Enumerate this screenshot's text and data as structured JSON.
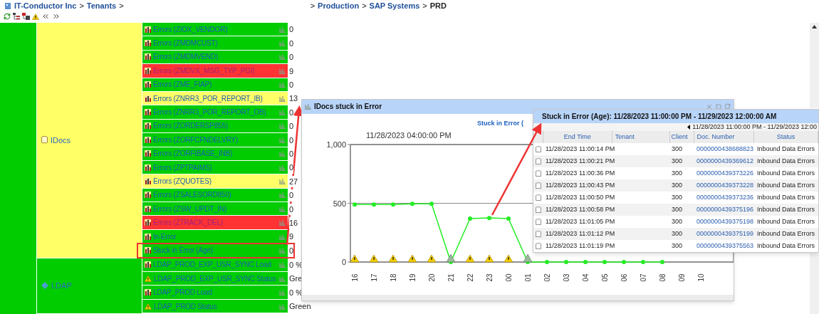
{
  "breadcrumb": {
    "start": [
      {
        "label": "IT-Conductor Inc",
        "kind": "link"
      },
      {
        "label": ">",
        "kind": "sep"
      },
      {
        "label": "Tenants",
        "kind": "link"
      },
      {
        "label": ">",
        "kind": "sep"
      }
    ],
    "end": [
      {
        "label": ">",
        "kind": "sep"
      },
      {
        "label": "Production",
        "kind": "link"
      },
      {
        "label": ">",
        "kind": "sep"
      },
      {
        "label": "SAP Systems",
        "kind": "link"
      },
      {
        "label": ">",
        "kind": "sep"
      },
      {
        "label": "PRD",
        "kind": "current"
      }
    ]
  },
  "toolbar": [
    {
      "kind": "refresh"
    },
    {
      "kind": "tree"
    },
    {
      "kind": "tree-red"
    },
    {
      "kind": "warning"
    },
    {
      "kind": "prev"
    },
    {
      "kind": "next"
    }
  ],
  "root": {
    "color": "#00cc00"
  },
  "groups": [
    {
      "label": "IDocs",
      "kind": "database",
      "color": "#ffff66",
      "rows": [
        {
          "name": "Errors (ZIOX_VENDOR)",
          "color": "#00cc00",
          "kind": "metric",
          "value": "0",
          "highlighted": false
        },
        {
          "name": "Errors (ZMDMCUST)",
          "color": "#00cc00",
          "kind": "metric",
          "value": "0",
          "highlighted": false
        },
        {
          "name": "Errors (ZMDMVEND)",
          "color": "#00cc00",
          "kind": "metric",
          "value": "0",
          "highlighted": false
        },
        {
          "name": "Errors (ZMDVX_MSG_TYP_PGI)",
          "color": "#ff3333",
          "kind": "metric",
          "value": "9",
          "highlighted": false
        },
        {
          "name": "Errors (ZME_FIAP)",
          "color": "#00cc00",
          "kind": "metric",
          "value": "0",
          "highlighted": false
        },
        {
          "name": "Errors (ZNRR3_POR_REPORT_IB)",
          "color": "#ffff66",
          "kind": "metric",
          "value": "13",
          "highlighted": false
        },
        {
          "name": "Errors (ZNRR3_POR_REPORT_OB)",
          "color": "#00cc00",
          "kind": "metric",
          "value": "0",
          "highlighted": false
        },
        {
          "name": "Errors (ZORDERSP855)",
          "color": "#00cc00",
          "kind": "metric",
          "value": "0",
          "highlighted": false
        },
        {
          "name": "Errors (ZORFCFNDELVRY)",
          "color": "#00cc00",
          "kind": "metric",
          "value": "0",
          "highlighted": false
        },
        {
          "name": "Errors (ZORFIBASE_INB)",
          "color": "#00cc00",
          "kind": "metric",
          "value": "0",
          "highlighted": false
        },
        {
          "name": "Errors (ZPTPAIMS)",
          "color": "#00cc00",
          "kind": "metric",
          "value": "0",
          "highlighted": false
        },
        {
          "name": "Errors (ZQUOTES)",
          "color": "#ffff66",
          "kind": "metric",
          "value": "27",
          "highlighted": false
        },
        {
          "name": "Errors (ZSALESORD850)",
          "color": "#00cc00",
          "kind": "metric",
          "value": "0",
          "highlighted": false
        },
        {
          "name": "Errors (ZSW_UPDT_IN)",
          "color": "#00cc00",
          "kind": "metric",
          "value": "0",
          "highlighted": false
        },
        {
          "name": "Errors (ZTRACK_DEL)",
          "color": "#ff3333",
          "kind": "metric",
          "value": "16",
          "highlighted": false
        },
        {
          "name": "In-Error",
          "color": "#00cc00",
          "kind": "metric",
          "value": "9",
          "highlighted": false
        },
        {
          "name": "Stuck in Error (Age)",
          "color": "#00cc00",
          "kind": "metric",
          "value": "0",
          "highlighted": true
        }
      ]
    },
    {
      "label": "LDAP",
      "kind": "service",
      "color": "#00cc00",
      "rows": [
        {
          "name": "LDAP_PROD_EXP_USR_SYNC Load",
          "color": "#00cc00",
          "kind": "metric",
          "value": "0 %",
          "highlighted": false
        },
        {
          "name": "LDAP_PROD_EXP_USR_SYNC Status",
          "color": "#00cc00",
          "kind": "status",
          "value": "Gre",
          "highlighted": false
        },
        {
          "name": "LDAP_PROD Load",
          "color": "#00cc00",
          "kind": "metric",
          "value": "0 %",
          "highlighted": false
        },
        {
          "name": "LDAP_PROD Status",
          "color": "#00cc00",
          "kind": "status",
          "value": "Green",
          "highlighted": false
        }
      ]
    }
  ],
  "chart_window": {
    "title": "IDocs stuck in Error",
    "date_label": "11/28/2023 04:00:00 PM",
    "events": [
      {
        "kind": "warning"
      },
      {
        "kind": "warning"
      },
      {
        "kind": "warning"
      },
      {
        "kind": "warning"
      },
      {
        "kind": "warning"
      },
      {
        "kind": "ok"
      },
      {
        "kind": "warning"
      },
      {
        "kind": "warning"
      },
      {
        "kind": "warning"
      },
      {
        "kind": "ok"
      }
    ],
    "chart_data": {
      "type": "line",
      "categories": [
        "16",
        "17",
        "18",
        "19",
        "20",
        "21",
        "22",
        "23",
        "00",
        "01",
        "02",
        "03",
        "04",
        "05",
        "06",
        "07",
        "08",
        "09",
        "10"
      ],
      "series": [
        {
          "name": "Stuck in Error (",
          "color": "#22ee22",
          "marker": true,
          "values": [
            490,
            490,
            490,
            495,
            495,
            0,
            370,
            375,
            370,
            0,
            0,
            0,
            0,
            0,
            0,
            0,
            0,
            null,
            null
          ]
        }
      ],
      "ylim": [
        0,
        1000
      ],
      "yticks": [
        0,
        500,
        {
          "value": 1000,
          "label": "1,000"
        }
      ]
    }
  },
  "detail_window": {
    "title": "Stuck in Error (Age): 11/28/2023 11:00:00 PM - 11/29/2023 12:00:00 AM",
    "range": "11/28/2023 11:00:00 PM - 11/29/2023 12:00",
    "columns": [
      "End Time",
      "Tenant",
      "Client",
      "Doc. Number",
      "Status"
    ],
    "rows": [
      {
        "end_time": "11/28/2023 11:00:14 PM",
        "client": "300",
        "doc_number": "0000000438688823",
        "status": "Inbound Data Errors"
      },
      {
        "end_time": "11/28/2023 11:00:21 PM",
        "client": "300",
        "doc_number": "0000000439369612",
        "status": "Inbound Data Errors"
      },
      {
        "end_time": "11/28/2023 11:00:36 PM",
        "client": "300",
        "doc_number": "0000000439373226",
        "status": "Inbound Data Errors"
      },
      {
        "end_time": "11/28/2023 11:00:43 PM",
        "client": "300",
        "doc_number": "0000000439373228",
        "status": "Inbound Data Errors"
      },
      {
        "end_time": "11/28/2023 11:00:50 PM",
        "client": "300",
        "doc_number": "0000000439373236",
        "status": "Inbound Data Errors"
      },
      {
        "end_time": "11/28/2023 11:00:58 PM",
        "client": "300",
        "doc_number": "0000000439375196",
        "status": "Inbound Data Errors"
      },
      {
        "end_time": "11/28/2023 11:01:05 PM",
        "client": "300",
        "doc_number": "0000000439375198",
        "status": "Inbound Data Errors"
      },
      {
        "end_time": "11/28/2023 11:01:12 PM",
        "client": "300",
        "doc_number": "0000000439375199",
        "status": "Inbound Data Errors"
      },
      {
        "end_time": "11/28/2023 11:01:19 PM",
        "client": "300",
        "doc_number": "0000000439375563",
        "status": "Inbound Data Errors"
      }
    ]
  }
}
